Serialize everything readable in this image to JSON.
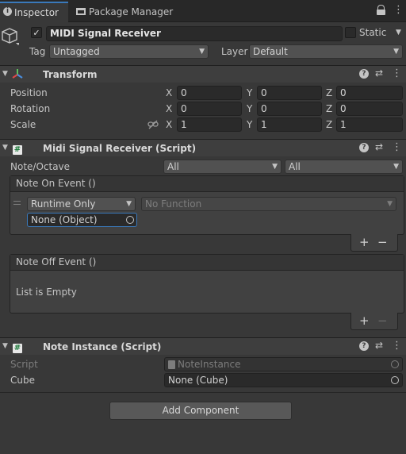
{
  "tabs": {
    "inspector": "Inspector",
    "package_manager": "Package Manager"
  },
  "object": {
    "name": "MIDI Signal Receiver",
    "static_label": "Static",
    "tag_label": "Tag",
    "tag_value": "Untagged",
    "layer_label": "Layer",
    "layer_value": "Default"
  },
  "transform": {
    "title": "Transform",
    "position_label": "Position",
    "rotation_label": "Rotation",
    "scale_label": "Scale",
    "x": "X",
    "y": "Y",
    "z": "Z",
    "position": [
      "0",
      "0",
      "0"
    ],
    "rotation": [
      "0",
      "0",
      "0"
    ],
    "scale": [
      "1",
      "1",
      "1"
    ]
  },
  "midi": {
    "title": "Midi Signal Receiver (Script)",
    "note_octave_label": "Note/Octave",
    "note_value": "All",
    "octave_value": "All",
    "note_on_title": "Note On Event ()",
    "runtime_value": "Runtime Only",
    "function_value": "No Function",
    "object_value": "None (Object)",
    "note_off_title": "Note Off Event ()",
    "list_empty": "List is Empty"
  },
  "note_instance": {
    "title": "Note Instance (Script)",
    "script_label": "Script",
    "script_value": "NoteInstance",
    "cube_label": "Cube",
    "cube_value": "None (Cube)"
  },
  "add_component": "Add Component",
  "colors": {
    "background": "#383838",
    "accent_blue": "#3a79bb",
    "transform_icon_red": "#e04848",
    "transform_icon_green": "#5cc05c",
    "transform_icon_blue": "#4a8fe0"
  },
  "symbols": {
    "plus": "+",
    "minus": "−",
    "more": "⋮",
    "lock": "🔒",
    "help": "?",
    "settings": "⇄",
    "hash": "#",
    "check": "✓"
  }
}
